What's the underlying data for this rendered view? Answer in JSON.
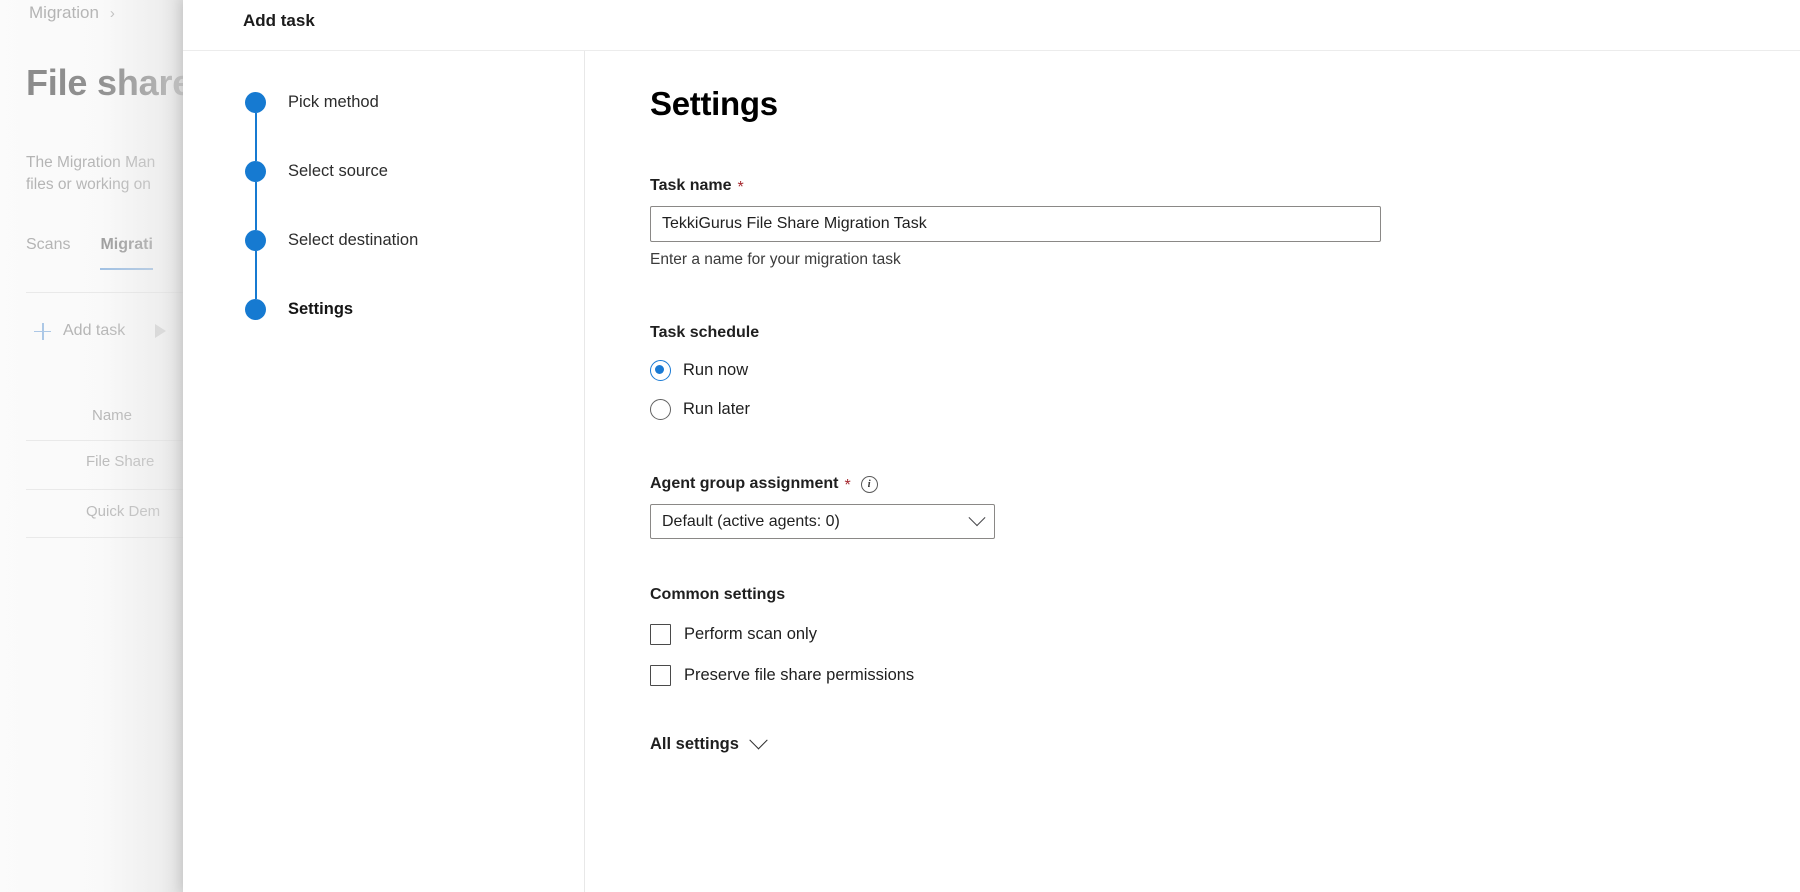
{
  "background": {
    "breadcrumb": {
      "label": "Migration",
      "chevron": "chevron-right-icon"
    },
    "page_title": "File share",
    "page_description": "The Migration Man\nfiles or working on",
    "tabs": [
      {
        "label": "Scans",
        "active": false
      },
      {
        "label": "Migrati",
        "active": true
      }
    ],
    "command_bar": {
      "add_task_label": "Add task",
      "plus_icon": "plus-icon",
      "run_icon": "play-icon"
    },
    "table": {
      "columns": [
        "Name"
      ],
      "rows": [
        {
          "name": "File Share "
        },
        {
          "name": "Quick Dem"
        }
      ]
    }
  },
  "panel": {
    "title": "Add task",
    "steps": [
      {
        "label": "Pick method",
        "current": false
      },
      {
        "label": "Select source",
        "current": false
      },
      {
        "label": "Select destination",
        "current": false
      },
      {
        "label": "Settings",
        "current": true
      }
    ],
    "content": {
      "heading": "Settings",
      "task_name": {
        "label": "Task name",
        "required_marker": "*",
        "value": "TekkiGurus File Share Migration Task",
        "placeholder": "Enter a name for your migration task",
        "hint": "Enter a name for your migration task"
      },
      "task_schedule": {
        "title": "Task schedule",
        "options": [
          {
            "label": "Run now",
            "selected": true
          },
          {
            "label": "Run later",
            "selected": false
          }
        ]
      },
      "agent_group": {
        "label": "Agent group assignment",
        "required_marker": "*",
        "info_icon": "info-icon",
        "info_glyph": "i",
        "selected": "Default (active agents: 0)",
        "chevron": "chevron-down-icon"
      },
      "common_settings": {
        "title": "Common settings",
        "checkboxes": [
          {
            "label": "Perform scan only",
            "checked": false
          },
          {
            "label": "Preserve file share permissions",
            "checked": false
          }
        ]
      },
      "all_settings": {
        "label": "All settings",
        "chevron": "chevron-down-icon"
      }
    }
  },
  "colors": {
    "accent": "#167ad1",
    "required": "#a4262c",
    "panel_border": "#e8e8e8",
    "tab_underline": "#7aaade"
  }
}
